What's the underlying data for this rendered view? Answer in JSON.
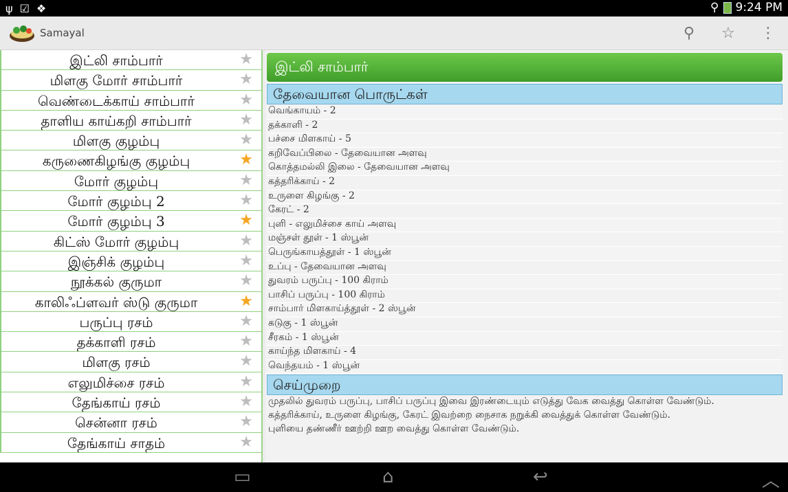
{
  "statusbar": {
    "left_icons": [
      "usb-icon",
      "check-icon",
      "dropbox-icon"
    ],
    "time": "9:24 PM",
    "right_icons": [
      "wifi-icon",
      "battery-icon"
    ]
  },
  "actionbar": {
    "app_title": "Samayal",
    "icons": [
      "search-icon",
      "star-icon",
      "overflow-menu-icon"
    ]
  },
  "recipes": [
    {
      "label": "இட்லி சாம்பார்",
      "starred": false
    },
    {
      "label": "மிளகு மோர் சாம்பார்",
      "starred": false
    },
    {
      "label": "வெண்டைக்காய் சாம்பார்",
      "starred": false
    },
    {
      "label": "தாளிய காய்கறி சாம்பார்",
      "starred": false
    },
    {
      "label": "மிளகு குழம்பு",
      "starred": false
    },
    {
      "label": "கருணைகிழங்கு குழம்பு",
      "starred": true
    },
    {
      "label": "மோர் குழம்பு",
      "starred": false
    },
    {
      "label": "மோர் குழம்பு 2",
      "starred": false
    },
    {
      "label": "மோர் குழம்பு 3",
      "starred": true
    },
    {
      "label": "கிட்ஸ் மோர் குழம்பு",
      "starred": false
    },
    {
      "label": "இஞ்சிக் குழம்பு",
      "starred": false
    },
    {
      "label": "நூக்கல் குருமா",
      "starred": false
    },
    {
      "label": "காலிஃப்ளவர் ஸ்டு குருமா",
      "starred": true
    },
    {
      "label": "பருப்பு ரசம்",
      "starred": false
    },
    {
      "label": "தக்காளி ரசம்",
      "starred": false
    },
    {
      "label": "மிளகு ரசம்",
      "starred": false
    },
    {
      "label": "எலுமிச்சை ரசம்",
      "starred": false
    },
    {
      "label": "தேங்காய் ரசம்",
      "starred": false
    },
    {
      "label": "சென்னா ரசம்",
      "starred": false
    },
    {
      "label": "தேங்காய் சாதம்",
      "starred": false
    }
  ],
  "detail": {
    "title": "இட்லி சாம்பார்",
    "ingredients_heading": "தேவையான பொருட்கள்",
    "ingredients": [
      "வெங்காயம் - 2",
      "தக்காளி - 2",
      "பச்சை மிளகாய் - 5",
      "கறிவேப்பிலை - தேவையான அளவு",
      "கொத்தமல்லி இலை - தேவையான அளவு",
      "கத்தரிக்காய் - 2",
      "உருளை கிழங்கு - 2",
      "கேரட் - 2",
      "புளி - எலுமிச்சை காய் அளவு",
      "மஞ்சள் தூள் - 1 ஸ்பூன்",
      "பெருங்காயத்தூள் - 1 ஸ்பூன்",
      "உப்பு - தேவையான அளவு",
      "துவரம் பருப்பு - 100 கிராம்",
      "பாசிப் பருப்பு - 100 கிராம்",
      "சாம்பார் மிளகாய்த்தூள் - 2 ஸ்பூன்",
      "கடுகு - 1 ஸ்பூன்",
      "சீரகம் - 1 ஸ்பூன்",
      "காய்ந்த மிளகாய் - 4",
      "வெந்தயம் - 1 ஸ்பூன்"
    ],
    "method_heading": "செய்முறை",
    "steps": [
      "முதலில் துவரம் பருப்பு, பாசிப் பருப்பு இவை இரண்டையும் எடுத்து வேக வைத்து கொள்ள வேண்டும்.",
      "கத்தரிக்காய், உருளை கிழங்கு, கேரட் இவற்றை நைசாக நறுக்கி வைத்துக் கொள்ள வேண்டும்.",
      "புளியை தண்ணீர் ஊற்றி ஊற வைத்து கொள்ள வேண்டும்."
    ]
  },
  "navbar": {
    "icons": [
      "recent-apps-icon",
      "home-icon",
      "back-icon",
      "up-arrow-icon"
    ]
  },
  "colors": {
    "title_bar": "#4fae35",
    "section_bar": "#a6d8ef",
    "list_border": "#8fd07f",
    "star_on": "#f5a623",
    "star_off": "#bdbdbd"
  }
}
